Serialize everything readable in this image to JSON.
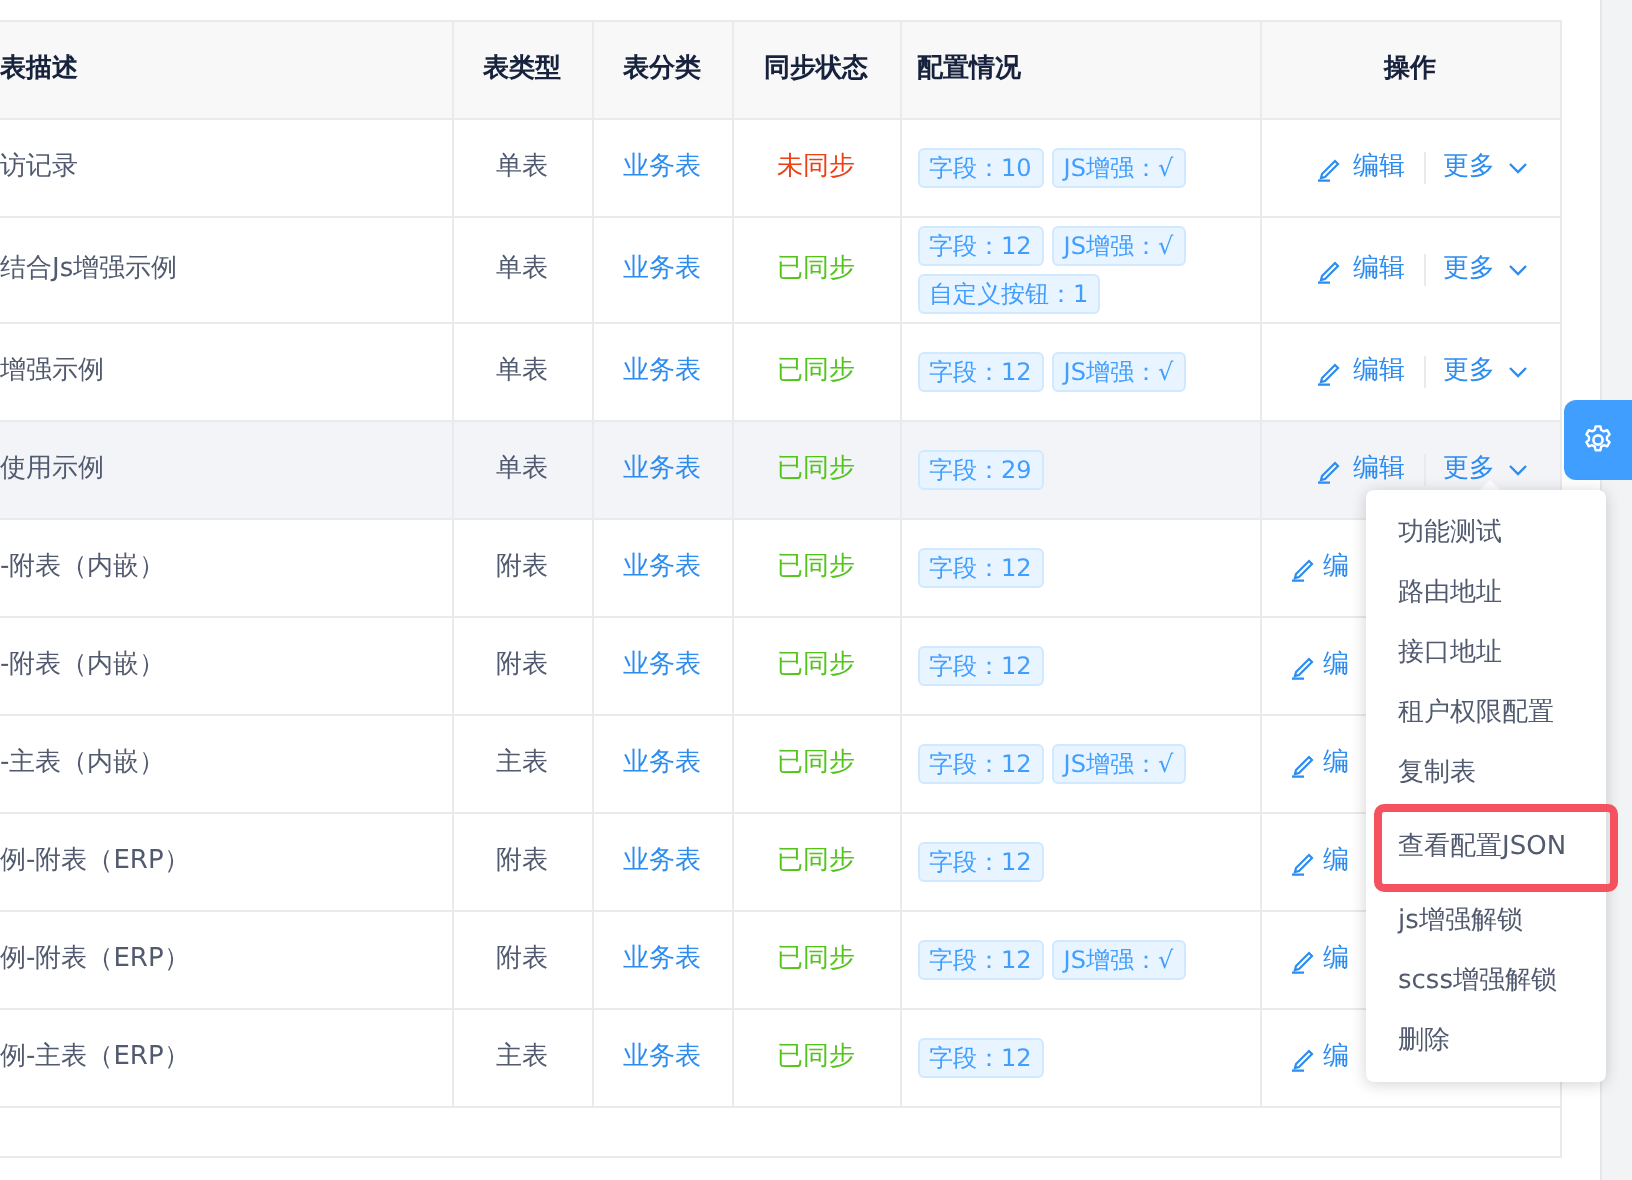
{
  "table": {
    "columns": [
      "表描述",
      "表类型",
      "表分类",
      "同步状态",
      "配置情况",
      "操作"
    ],
    "rows": [
      {
        "description": "访记录",
        "type": "单表",
        "category": "业务表",
        "synced": false,
        "sync_status": "未同步",
        "tags": [
          "字段：10",
          "JS增强：√"
        ],
        "edit": "编辑",
        "more": "更多",
        "highlighted": false
      },
      {
        "description": "结合Js增强示例",
        "type": "单表",
        "category": "业务表",
        "synced": true,
        "sync_status": "已同步",
        "tags": [
          "字段：12",
          "JS增强：√",
          "自定义按钮：1"
        ],
        "edit": "编辑",
        "more": "更多",
        "highlighted": false
      },
      {
        "description": "增强示例",
        "type": "单表",
        "category": "业务表",
        "synced": true,
        "sync_status": "已同步",
        "tags": [
          "字段：12",
          "JS增强：√"
        ],
        "edit": "编辑",
        "more": "更多",
        "highlighted": false
      },
      {
        "description": "使用示例",
        "type": "单表",
        "category": "业务表",
        "synced": true,
        "sync_status": "已同步",
        "tags": [
          "字段：29"
        ],
        "edit": "编辑",
        "more": "更多",
        "highlighted": true
      },
      {
        "description": "-附表（内嵌）",
        "type": "附表",
        "category": "业务表",
        "synced": true,
        "sync_status": "已同步",
        "tags": [
          "字段：12"
        ],
        "edit": "编",
        "highlighted": false
      },
      {
        "description": "-附表（内嵌）",
        "type": "附表",
        "category": "业务表",
        "synced": true,
        "sync_status": "已同步",
        "tags": [
          "字段：12"
        ],
        "edit": "编",
        "highlighted": false
      },
      {
        "description": "-主表（内嵌）",
        "type": "主表",
        "category": "业务表",
        "synced": true,
        "sync_status": "已同步",
        "tags": [
          "字段：12",
          "JS增强：√"
        ],
        "edit": "编",
        "highlighted": false
      },
      {
        "description": "例-附表（ERP）",
        "type": "附表",
        "category": "业务表",
        "synced": true,
        "sync_status": "已同步",
        "tags": [
          "字段：12"
        ],
        "edit": "编",
        "highlighted": false
      },
      {
        "description": "例-附表（ERP）",
        "type": "附表",
        "category": "业务表",
        "synced": true,
        "sync_status": "已同步",
        "tags": [
          "字段：12",
          "JS增强：√"
        ],
        "edit": "编",
        "highlighted": false
      },
      {
        "description": "例-主表（ERP）",
        "type": "主表",
        "category": "业务表",
        "synced": true,
        "sync_status": "已同步",
        "tags": [
          "字段：12"
        ],
        "edit": "编",
        "highlighted": false
      }
    ]
  },
  "dropdown_menu": {
    "items": [
      {
        "label": "功能测试",
        "highlighted": false
      },
      {
        "label": "路由地址",
        "highlighted": false
      },
      {
        "label": "接口地址",
        "highlighted": false
      },
      {
        "label": "租户权限配置",
        "highlighted": false
      },
      {
        "label": "复制表",
        "highlighted": false
      },
      {
        "label": "查看配置JSON",
        "highlighted": true
      },
      {
        "label": "js增强解锁",
        "highlighted": false
      },
      {
        "label": "scss增强解锁",
        "highlighted": false
      },
      {
        "label": "删除",
        "highlighted": false
      }
    ]
  }
}
